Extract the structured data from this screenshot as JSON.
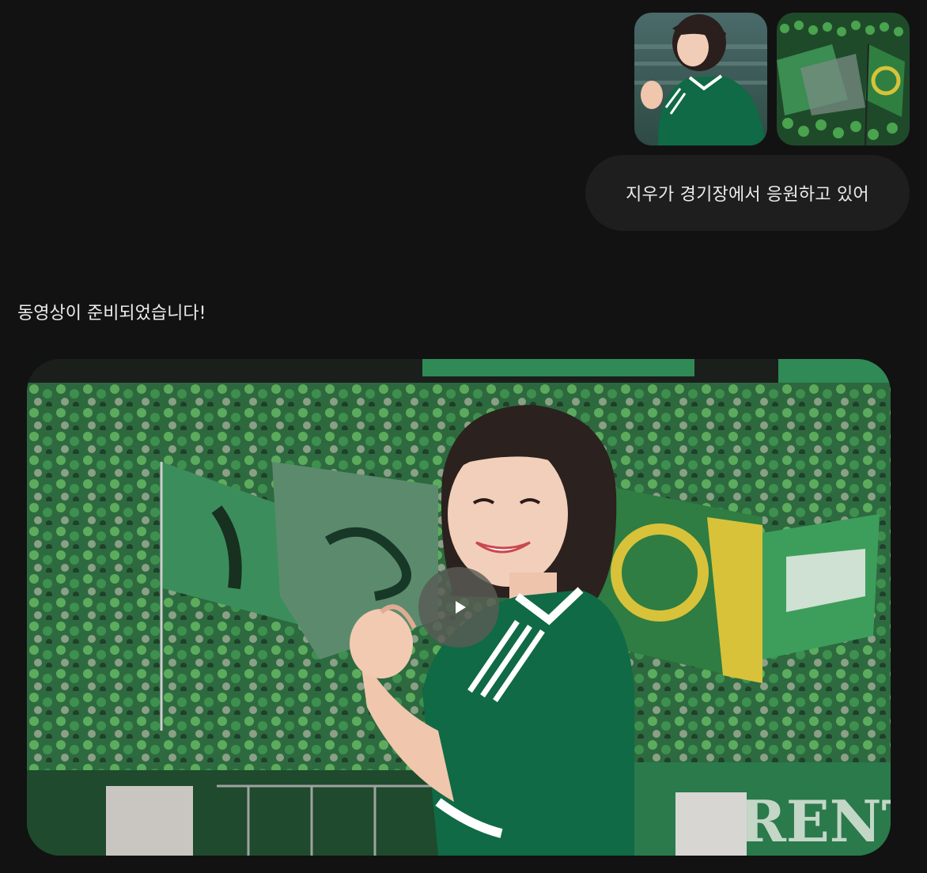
{
  "conversation": {
    "user_message": {
      "attachments": [
        {
          "icon": "photo-fan-in-green-jersey-thumbnail"
        },
        {
          "icon": "photo-stadium-crowd-flags-thumbnail"
        }
      ],
      "text": "지우가 경기장에서 응원하고 있어"
    },
    "assistant_message": {
      "text": "동영상이 준비되었습니다!",
      "video": {
        "play_icon": "play-icon",
        "banner_text": "RENT"
      }
    }
  },
  "colors": {
    "background": "#121212",
    "bubble": "#1e1e1e",
    "jersey_green": "#0f6a45",
    "crowd_green": "#3e9a4f",
    "flag_yellow": "#d8c23a"
  }
}
